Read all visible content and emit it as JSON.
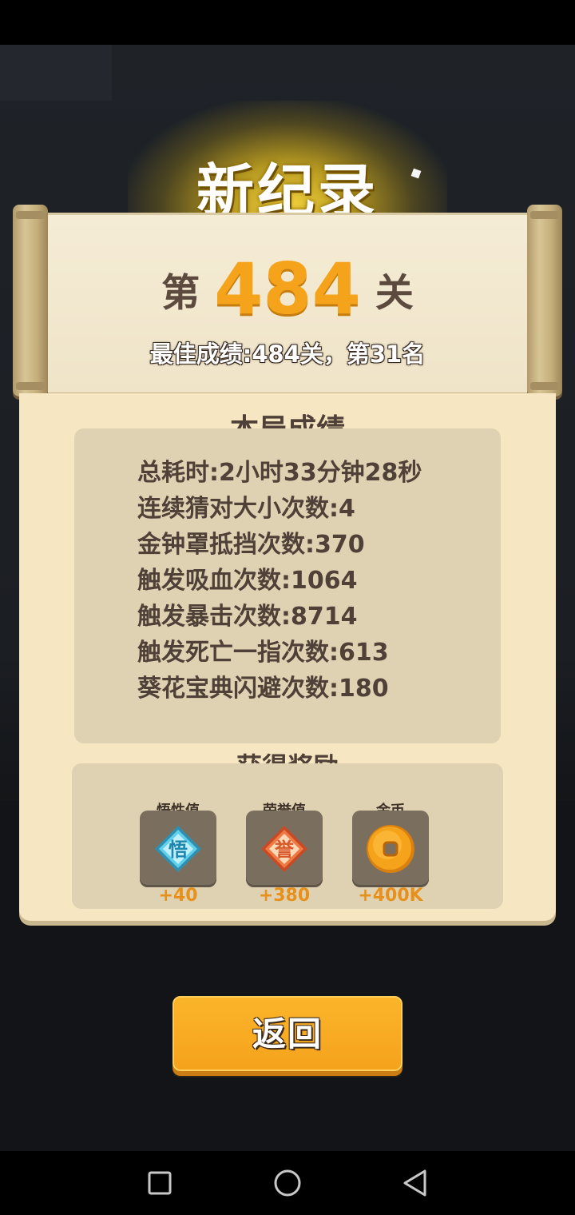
{
  "header": {
    "title": "新纪录"
  },
  "scroll": {
    "level_prefix": "第",
    "level_number": "484",
    "level_suffix": "关",
    "best_record": "最佳成绩:484关，第31名"
  },
  "panel": {
    "title": "本局成绩",
    "stats": [
      "总耗时:2小时33分钟28秒",
      "连续猜对大小次数:4",
      "金钟罩抵挡次数:370",
      "触发吸血次数:1064",
      "触发暴击次数:8714",
      "触发死亡一指次数:613",
      "葵花宝典闪避次数:180"
    ]
  },
  "rewards": {
    "title": "获得奖励",
    "items": [
      {
        "label": "悟性值",
        "amount": "+40",
        "icon": "wuxing-diamond-icon",
        "glyph": "悟",
        "color": "#4fc8e8"
      },
      {
        "label": "荣誉值",
        "amount": "+380",
        "icon": "honor-diamond-icon",
        "glyph": "誉",
        "color": "#e8643a"
      },
      {
        "label": "金币",
        "amount": "+400K",
        "icon": "gold-coin-icon",
        "color": "#f5a31a"
      }
    ]
  },
  "actions": {
    "back_label": "返回"
  },
  "nav": {
    "buttons": [
      "recent-apps",
      "home",
      "back"
    ]
  }
}
